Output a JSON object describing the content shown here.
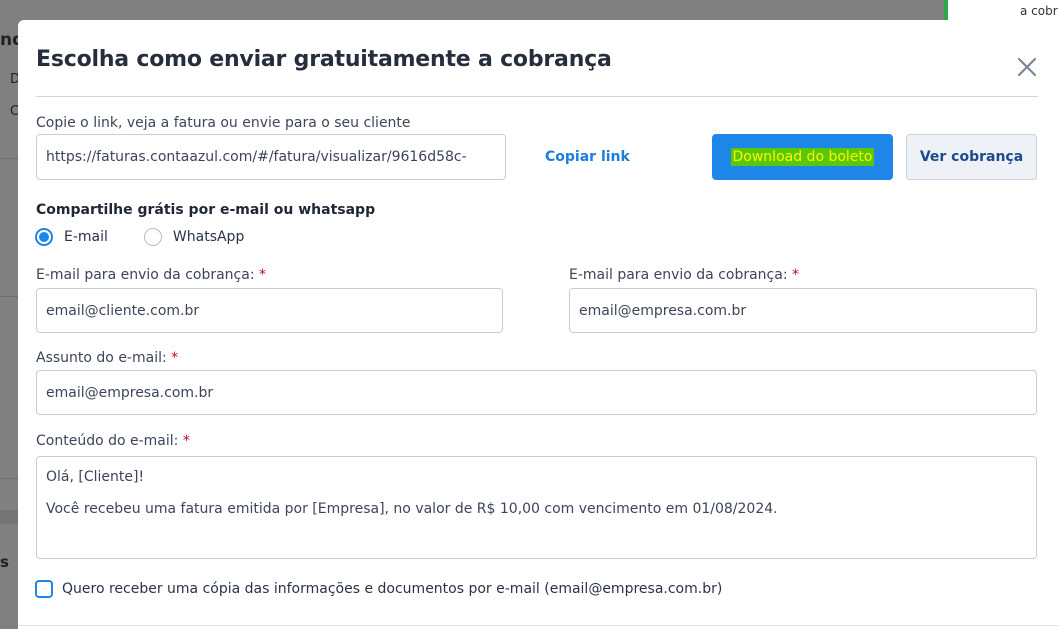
{
  "background": {
    "fragments": [
      "nd",
      "D",
      "C",
      "s"
    ]
  },
  "toast": {
    "text": "a cobr"
  },
  "modal": {
    "title": "Escolha como enviar gratuitamente a cobrança",
    "close_icon": "close-icon",
    "link_section": {
      "label": "Copie o link, veja a fatura ou envie para o seu cliente",
      "link_value": "https://faturas.contaazul.com/#/fatura/visualizar/9616d58c-",
      "copy_label": "Copiar link",
      "download_label": "Download do boleto",
      "view_label": "Ver cobrança"
    },
    "share_section": {
      "title": "Compartilhe grátis por e-mail ou whatsapp",
      "options": [
        {
          "label": "E-mail",
          "checked": true
        },
        {
          "label": "WhatsApp",
          "checked": false
        }
      ]
    },
    "email_to": {
      "label": "E-mail para envio da cobrança:",
      "required_mark": "*",
      "value": "email@cliente.com.br"
    },
    "email_from": {
      "label": "E-mail para envio da cobrança:",
      "required_mark": "*",
      "value": "email@empresa.com.br"
    },
    "subject": {
      "label": "Assunto do e-mail:",
      "required_mark": "*",
      "value": "email@empresa.com.br"
    },
    "content": {
      "label": "Conteúdo do e-mail:",
      "required_mark": "*",
      "lines": [
        "Olá, [Cliente]!",
        "Você recebeu uma fatura emitida por [Empresa], no valor de R$ 10,00 com vencimento em 01/08/2024."
      ]
    },
    "copy_checkbox": {
      "label": "Quero receber uma cópia das informações e documentos por e-mail (email@empresa.com.br)",
      "checked": false
    }
  },
  "colors": {
    "primary": "#1e86e8",
    "required": "#d0021b",
    "toast_accent": "#2aa84a",
    "download_highlight_bg": "#5ac80a",
    "download_highlight_text": "#fff200"
  }
}
